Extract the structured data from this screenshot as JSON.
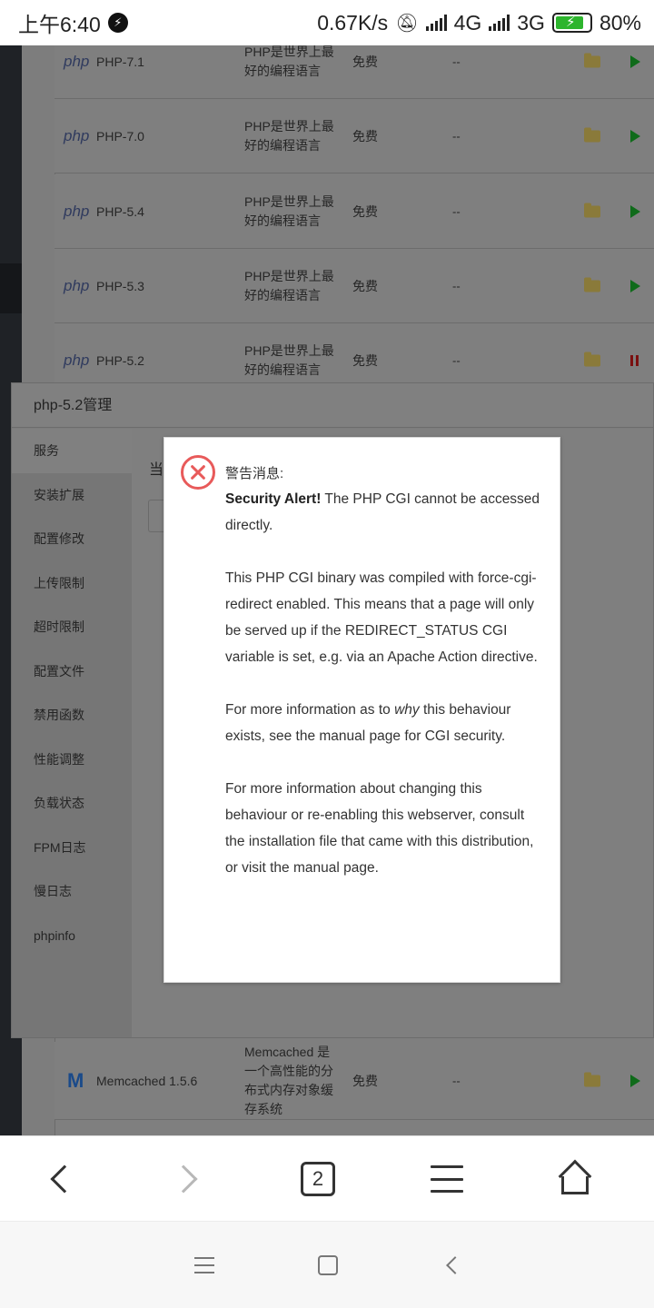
{
  "status_bar": {
    "time": "上午6:40",
    "net_speed": "0.67K/s",
    "net_4g": "4G",
    "net_3g": "3G",
    "battery": "80%"
  },
  "software_rows_top": [
    {
      "logo": "php",
      "name": "PHP-7.1",
      "desc": "PHP是世界上最好的编程语言",
      "price": "免费",
      "expire": "--",
      "action": "play"
    },
    {
      "logo": "php",
      "name": "PHP-7.0",
      "desc": "PHP是世界上最好的编程语言",
      "price": "免费",
      "expire": "--",
      "action": "play"
    },
    {
      "logo": "php",
      "name": "PHP-5.4",
      "desc": "PHP是世界上最好的编程语言",
      "price": "免费",
      "expire": "--",
      "action": "play"
    },
    {
      "logo": "php",
      "name": "PHP-5.3",
      "desc": "PHP是世界上最好的编程语言",
      "price": "免费",
      "expire": "--",
      "action": "play"
    },
    {
      "logo": "php",
      "name": "PHP-5.2",
      "desc": "PHP是世界上最好的编程语言",
      "price": "免费",
      "expire": "--",
      "action": "pause"
    }
  ],
  "software_row_bottom": {
    "logo": "M",
    "name": "Memcached 1.5.6",
    "desc": "Memcached 是一个高性能的分布式内存对象缓存系统",
    "price": "免费",
    "expire": "--",
    "action": "play"
  },
  "manager": {
    "title": "php-5.2管理",
    "menu": [
      "服务",
      "安装扩展",
      "配置修改",
      "上传限制",
      "超时限制",
      "配置文件",
      "禁用函数",
      "性能调整",
      "负载状态",
      "FPM日志",
      "慢日志",
      "phpinfo"
    ],
    "active_index": 0,
    "body_fragment": "当"
  },
  "alert": {
    "title": "警告消息:",
    "p1_bold": "Security Alert!",
    "p1_text": " The PHP CGI cannot be accessed directly.",
    "p2": "This PHP CGI binary was compiled with force-cgi-redirect enabled. This means that a page will only be served up if the REDIRECT_STATUS CGI variable is set, e.g. via an Apache Action directive.",
    "p3_a": "For more information as to ",
    "p3_em": "why",
    "p3_b": " this behaviour exists, see the manual page for CGI security.",
    "p4": "For more information about changing this behaviour or re-enabling this webserver, consult the installation file that came with this distribution, or visit the manual page."
  },
  "browser_toolbar": {
    "tab_count": "2"
  }
}
